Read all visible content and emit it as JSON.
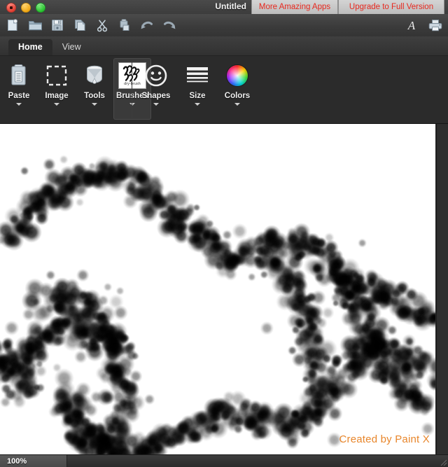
{
  "window": {
    "title": "Untitled",
    "traffic_lights": [
      "close",
      "minimize",
      "maximize"
    ],
    "promo_buttons": [
      {
        "label": "More Amazing Apps"
      },
      {
        "label": "Upgrade to Full Version"
      }
    ]
  },
  "toolbar": {
    "items": [
      {
        "name": "new-icon",
        "label": "New"
      },
      {
        "name": "open-icon",
        "label": "Open"
      },
      {
        "name": "save-icon",
        "label": "Save"
      },
      {
        "name": "copy-icon",
        "label": "Copy"
      },
      {
        "name": "cut-icon",
        "label": "Cut"
      },
      {
        "name": "paste-icon",
        "label": "Paste"
      },
      {
        "name": "undo-icon",
        "label": "Undo"
      },
      {
        "name": "redo-icon",
        "label": "Redo"
      }
    ],
    "right_items": [
      {
        "name": "text-tool-icon",
        "label": "A"
      },
      {
        "name": "print-icon",
        "label": "Print"
      }
    ]
  },
  "tabs": [
    {
      "label": "Home",
      "active": true
    },
    {
      "label": "View",
      "active": false
    }
  ],
  "ribbon": {
    "groups": [
      {
        "items": [
          {
            "label": "Paste",
            "icon": "clipboard-icon",
            "caret": true,
            "selected": false
          },
          {
            "label": "Image",
            "icon": "selection-marquee-icon",
            "caret": true,
            "selected": false
          },
          {
            "label": "Tools",
            "icon": "paint-bucket-icon",
            "caret": true,
            "selected": false
          },
          {
            "label": "Brushes",
            "icon": "brush-thumbnail-icon",
            "caret": true,
            "selected": true,
            "thumb_caption": "dry-brush"
          }
        ]
      },
      {
        "items": [
          {
            "label": "Shapes",
            "icon": "smiley-shape-icon",
            "caret": true,
            "selected": false
          },
          {
            "label": "Size",
            "icon": "line-size-icon",
            "caret": true,
            "selected": false
          },
          {
            "label": "Colors",
            "icon": "color-wheel-icon",
            "caret": true,
            "selected": false
          }
        ]
      }
    ]
  },
  "canvas": {
    "watermark": "Created by Paint X",
    "background_color": "#ffffff",
    "artwork": {
      "brush": "airbrush-soft-round",
      "color": "#000000",
      "description": "Scattered soft black airbrush dabs forming two arching wave-like strokes across the canvas"
    }
  },
  "statusbar": {
    "zoom": "100%"
  },
  "colors": {
    "promo_text": "#e8281e",
    "watermark": "#e8862b",
    "window_chrome": "#3c3c3c",
    "ribbon_bg": "#2b2b2b",
    "canvas_bg": "#ffffff"
  }
}
